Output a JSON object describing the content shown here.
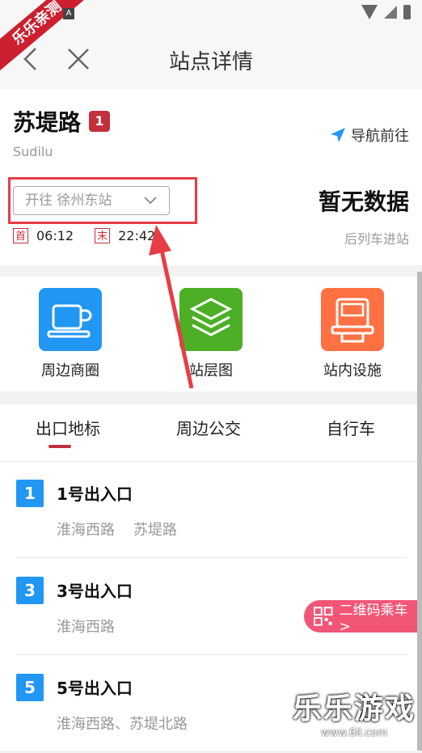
{
  "watermark_top": {
    "text": "乐乐亲测",
    "small_mark": "A"
  },
  "header": {
    "title": "站点详情"
  },
  "station": {
    "name": "苏堤路",
    "line": "1",
    "pinyin": "Sudilu",
    "nav_label": "导航前往",
    "direction": "开往 徐州东站",
    "first_tag": "首",
    "first_time": "06:12",
    "last_tag": "末",
    "last_time": "22:42",
    "status": "暂无数据",
    "next_train": "后列车进站"
  },
  "services": [
    {
      "label": "周边商圈",
      "icon": "coffee-cup-icon",
      "color": "#2196f3"
    },
    {
      "label": "站层图",
      "icon": "layers-icon",
      "color": "#4caf26"
    },
    {
      "label": "站内设施",
      "icon": "ticket-machine-icon",
      "color": "#ff7043"
    }
  ],
  "tabs": [
    "出口地标",
    "周边公交",
    "自行车"
  ],
  "exits": [
    {
      "num": "1",
      "name": "1号出入口",
      "roads": "淮海西路    苏堤路"
    },
    {
      "num": "3",
      "name": "3号出入口",
      "roads": "淮海西路"
    },
    {
      "num": "5",
      "name": "5号出入口",
      "roads": "淮海西路、苏堤北路"
    }
  ],
  "qr_button": {
    "label": "二维码乘车 >"
  },
  "watermark": {
    "title": "乐乐游戏",
    "url": "www.6ll.com"
  },
  "colors": {
    "accent": "#c3303c",
    "highlight": "#e63d46",
    "exit_blue": "#2196f3",
    "qr_pink": "#f25676"
  }
}
